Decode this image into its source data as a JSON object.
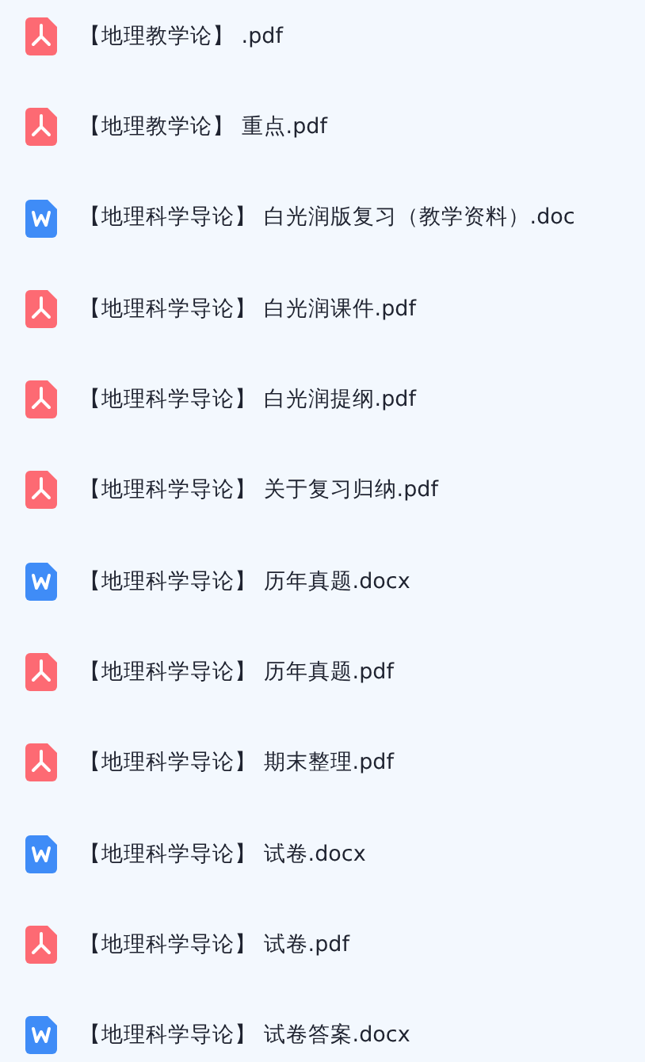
{
  "files": [
    {
      "kind": "pdf",
      "name": "【地理教学论】 .pdf"
    },
    {
      "kind": "pdf",
      "name": "【地理教学论】 重点.pdf"
    },
    {
      "kind": "word",
      "name": "【地理科学导论】 白光润版复习（教学资料）.doc"
    },
    {
      "kind": "pdf",
      "name": "【地理科学导论】 白光润课件.pdf"
    },
    {
      "kind": "pdf",
      "name": "【地理科学导论】 白光润提纲.pdf"
    },
    {
      "kind": "pdf",
      "name": "【地理科学导论】 关于复习归纳.pdf"
    },
    {
      "kind": "word",
      "name": "【地理科学导论】 历年真题.docx"
    },
    {
      "kind": "pdf",
      "name": "【地理科学导论】 历年真题.pdf"
    },
    {
      "kind": "pdf",
      "name": "【地理科学导论】 期末整理.pdf"
    },
    {
      "kind": "word",
      "name": "【地理科学导论】 试卷.docx"
    },
    {
      "kind": "pdf",
      "name": "【地理科学导论】 试卷.pdf"
    },
    {
      "kind": "word",
      "name": "【地理科学导论】 试卷答案.docx"
    }
  ]
}
